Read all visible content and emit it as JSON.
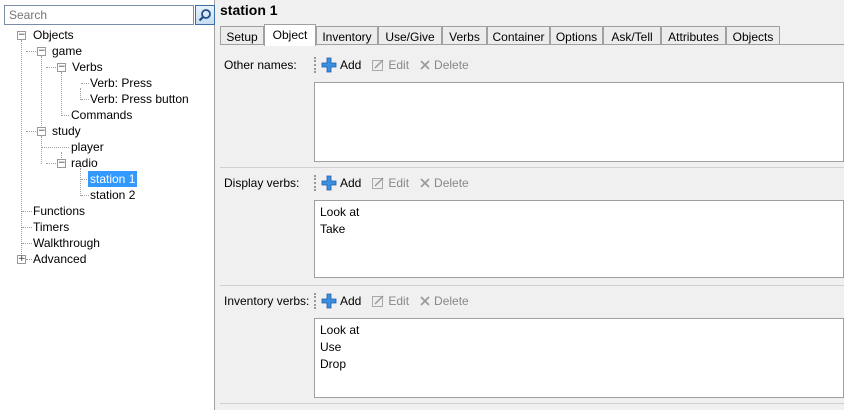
{
  "search": {
    "placeholder": "Search"
  },
  "tree": {
    "objects": "Objects",
    "game": "game",
    "verbs": "Verbs",
    "verb_press": "Verb: Press",
    "verb_press_button": "Verb: Press button",
    "commands": "Commands",
    "study": "study",
    "player": "player",
    "radio": "radio",
    "station1": "station 1",
    "station2": "station 2",
    "functions": "Functions",
    "timers": "Timers",
    "walkthrough": "Walkthrough",
    "advanced": "Advanced",
    "selected": "station 1"
  },
  "header": {
    "title": "station 1"
  },
  "tabs": [
    {
      "label": "Setup"
    },
    {
      "label": "Object",
      "active": true
    },
    {
      "label": "Inventory"
    },
    {
      "label": "Use/Give"
    },
    {
      "label": "Verbs"
    },
    {
      "label": "Container"
    },
    {
      "label": "Options"
    },
    {
      "label": "Ask/Tell"
    },
    {
      "label": "Attributes"
    },
    {
      "label": "Objects"
    }
  ],
  "toolbar": {
    "add": "Add",
    "edit": "Edit",
    "delete": "Delete"
  },
  "sections": {
    "other_names": {
      "label": "Other names:",
      "items": []
    },
    "display_verbs": {
      "label": "Display verbs:",
      "items": [
        "Look at",
        "Take"
      ]
    },
    "inventory_verbs": {
      "label": "Inventory verbs:",
      "items": [
        "Look at",
        "Use",
        "Drop"
      ]
    }
  },
  "colors": {
    "selection": "#3399ff",
    "add_icon": "#2a7fd4"
  }
}
